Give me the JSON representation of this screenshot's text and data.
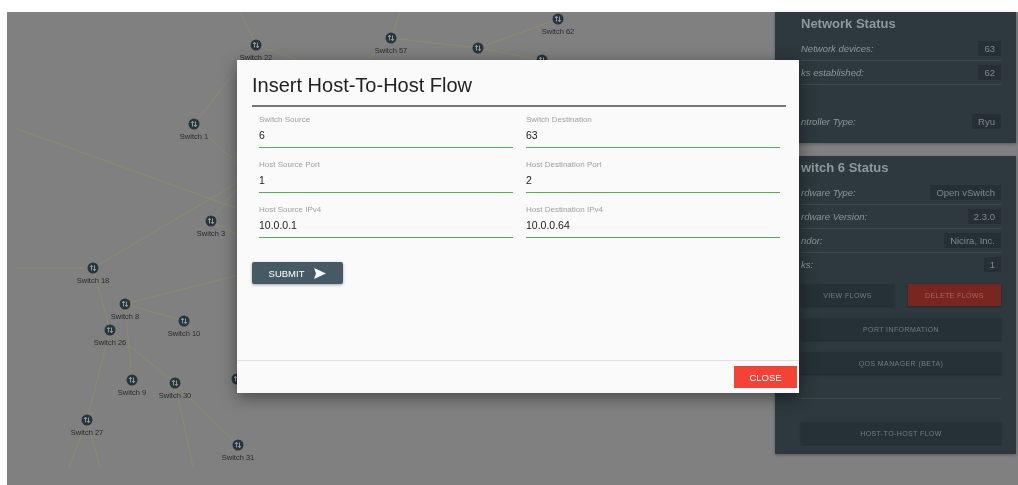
{
  "topology": {
    "nodes": [
      {
        "label": "Switch 22"
      },
      {
        "label": "Switch 57"
      },
      {
        "label": "Switch 62"
      },
      {
        "label": "Switch 1"
      },
      {
        "label": "Switch 3"
      },
      {
        "label": "Switch 18"
      },
      {
        "label": "Switch 8"
      },
      {
        "label": "Switch 10"
      },
      {
        "label": "Switch 26"
      },
      {
        "label": "Switch 9"
      },
      {
        "label": "Switch 30"
      },
      {
        "label": "Switch 27"
      },
      {
        "label": "Switch 31"
      }
    ]
  },
  "network_status": {
    "title": "Network Status",
    "rows": [
      {
        "label": "Network devices:",
        "value": "63"
      },
      {
        "label": "ks established:",
        "value": "62"
      },
      {
        "label": "ntroller Type:",
        "value": "Ryu"
      }
    ]
  },
  "switch_status": {
    "title": "witch 6 Status",
    "rows": [
      {
        "label": "rdware Type:",
        "value": "Open vSwitch"
      },
      {
        "label": "rdware Version:",
        "value": "2.3.0"
      },
      {
        "label": "ndor:",
        "value": "Nicira, Inc."
      },
      {
        "label": "ks:",
        "value": "1"
      }
    ],
    "buttons": [
      {
        "label": "VIEW FLOWS",
        "kind": "normal"
      },
      {
        "label": "DELETE FLOWS",
        "kind": "danger"
      },
      {
        "label": "PORT INFORMATION",
        "kind": "wide"
      },
      {
        "label": "QOS MANAGER (BETA)",
        "kind": "wide"
      },
      {
        "label": "HOST-TO-HOST FLOW",
        "kind": "separated"
      }
    ]
  },
  "dialog": {
    "title": "Insert Host-To-Host Flow",
    "fields": [
      {
        "label": "Switch Source",
        "value": "6"
      },
      {
        "label": "Switch Destination",
        "value": "63"
      },
      {
        "label": "Host Source Port",
        "value": "1"
      },
      {
        "label": "Host Destination Port",
        "value": "2"
      },
      {
        "label": "Host Source IPv4",
        "value": "10.0.0.1"
      },
      {
        "label": "Host Destination IPv4",
        "value": "10.0.0.64"
      }
    ],
    "submit": "SUBMIT",
    "close": "CLOSE"
  }
}
